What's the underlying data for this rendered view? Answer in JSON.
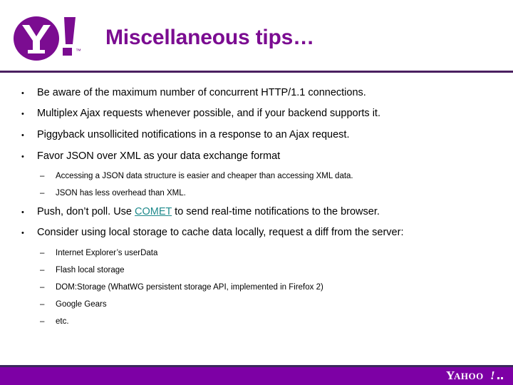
{
  "header": {
    "title": "Miscellaneous tips…",
    "logo_alt": "yahoo-bang-logo",
    "title_color": "#7B0C91",
    "rule_color": "#4A2060"
  },
  "content": {
    "bullet_marker": "•",
    "dash_marker": "–",
    "items": [
      {
        "level": 1,
        "text": "Be aware of the maximum number of concurrent HTTP/1.1 connections."
      },
      {
        "level": 1,
        "text": "Multiplex Ajax requests whenever possible, and if your backend supports it."
      },
      {
        "level": 1,
        "text": "Piggyback unsollicited notifications in a response to an Ajax request."
      },
      {
        "level": 1,
        "text": "Favor JSON over XML as your data exchange format"
      },
      {
        "level": 2,
        "text": "Accessing a JSON data structure is easier and cheaper than accessing XML data."
      },
      {
        "level": 2,
        "text": "JSON has less overhead than XML."
      },
      {
        "level": 1,
        "text_before": "Push, don’t poll. Use ",
        "link": "COMET",
        "text_after": " to send real-time notifications to the browser."
      },
      {
        "level": 1,
        "text": "Consider using local storage to cache data locally, request a diff from the server:"
      },
      {
        "level": 2,
        "text": "Internet Explorer’s userData"
      },
      {
        "level": 2,
        "text": "Flash local storage"
      },
      {
        "level": 2,
        "text": "DOM:Storage (WhatWG persistent storage API, implemented in Firefox 2)"
      },
      {
        "level": 2,
        "text": "Google Gears"
      },
      {
        "level": 2,
        "text": "etc."
      }
    ],
    "link_color": "#1F8A8C"
  },
  "footer": {
    "wordmark": "YAHOO!",
    "bar_color": "#7D00A5",
    "top_stripe_color": "#3A2A5C"
  }
}
